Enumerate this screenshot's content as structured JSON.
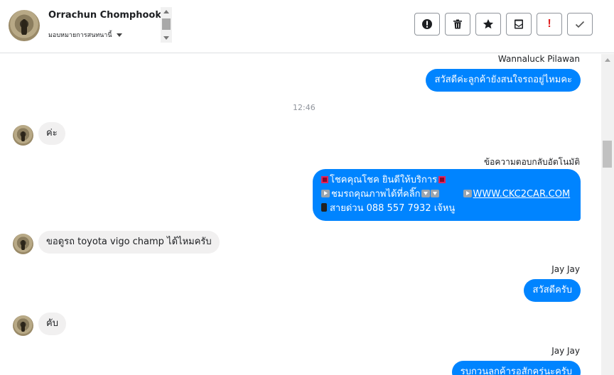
{
  "header": {
    "contact_name": "Orrachun Chomphookao",
    "assign_label": "มอบหมายการสนทนานี้",
    "toolbar": [
      {
        "name": "mark-spam-button",
        "icon": "alert-circle-icon"
      },
      {
        "name": "delete-button",
        "icon": "trash-icon"
      },
      {
        "name": "star-button",
        "icon": "star-icon"
      },
      {
        "name": "mark-unread-button",
        "icon": "envelope-icon"
      },
      {
        "name": "follow-up-button",
        "icon": "exclamation-icon",
        "glyph": "!"
      },
      {
        "name": "mark-done-button",
        "icon": "checkmark-icon"
      }
    ]
  },
  "messages": {
    "m1": {
      "sender": "Wannaluck Pilawan",
      "text": "สวัสดีค่ะลูกค้ายังสนใจรถอยู่ไหมคะ"
    },
    "timestamp": "12:46",
    "m2": {
      "text": "ค่ะ"
    },
    "m3": {
      "sender": "ข้อความตอบกลับอัตโนมัติ",
      "line1": "โชคคุณโชค ยินดีให้บริการ",
      "line2_text": "ชมรถคุณภาพได้ที่คลิ๊ก",
      "line2_link": "WWW.CKC2CAR.COM",
      "line3": "สายด่วน 088 557 7932 เจ้หนู"
    },
    "m4": {
      "text": "ขอดูรถ toyota vigo champ ได้ไหมครับ"
    },
    "m5": {
      "sender": "Jay Jay",
      "text": "สวัสดีครับ"
    },
    "m6": {
      "text": "คับ"
    },
    "m7": {
      "sender": "Jay Jay",
      "text": "รบกวนลูกค้ารอสักครู่นะครับ"
    }
  },
  "colors": {
    "outgoing_bubble": "#0084ff",
    "incoming_bubble": "#f1f0f0",
    "follow_up_red": "#e02020"
  }
}
